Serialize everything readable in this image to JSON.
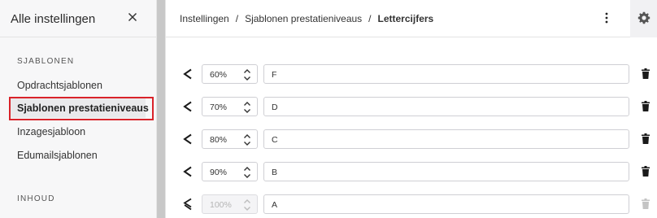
{
  "sidebar": {
    "title": "Alle instellingen",
    "sections": [
      {
        "label": "SJABLONEN",
        "items": [
          {
            "label": "Opdrachtsjablonen",
            "active": false
          },
          {
            "label": "Sjablonen prestatieniveaus",
            "active": true
          },
          {
            "label": "Inzagesjabloon",
            "active": false
          },
          {
            "label": "Edumailsjablonen",
            "active": false
          }
        ]
      },
      {
        "label": "INHOUD",
        "items": []
      }
    ]
  },
  "header": {
    "breadcrumb": [
      "Instellingen",
      "Sjablonen prestatieniveaus",
      "Lettercijfers"
    ],
    "separator": "/"
  },
  "grades": [
    {
      "operator": "<",
      "percent": "60%",
      "letter": "F",
      "disabled": false
    },
    {
      "operator": "<",
      "percent": "70%",
      "letter": "D",
      "disabled": false
    },
    {
      "operator": "<",
      "percent": "80%",
      "letter": "C",
      "disabled": false
    },
    {
      "operator": "<",
      "percent": "90%",
      "letter": "B",
      "disabled": false
    },
    {
      "operator": "<=",
      "percent": "100%",
      "letter": "A",
      "disabled": true
    }
  ],
  "colors": {
    "highlight": "#d9232a",
    "icon": "#1a1a1a",
    "icon_disabled": "#c4c4c4"
  },
  "icons": {
    "close": "close-icon",
    "more": "more-vertical-icon",
    "settings": "gear-icon",
    "delete": "trash-icon",
    "stepper": "chevron-up-down-icon"
  }
}
